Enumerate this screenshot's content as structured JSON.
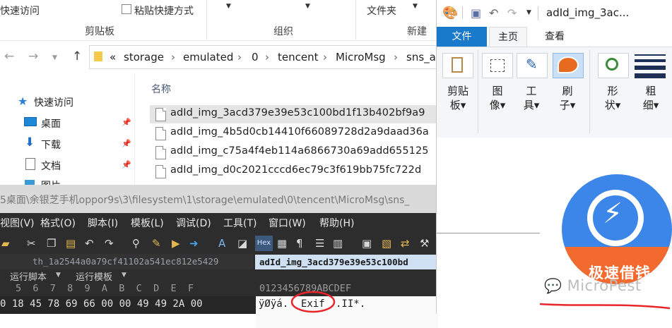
{
  "explorer": {
    "ribbon": {
      "quick_access": "快速访问",
      "paste_shortcut": "粘贴快捷方式",
      "new_folder": "文件夹",
      "groups": [
        "剪贴板",
        "组织",
        "新建"
      ]
    },
    "address": {
      "prefix": "«",
      "segments": [
        "storage",
        "emulated",
        "0",
        "tencent",
        "MicroMsg",
        "sns_ad"
      ],
      "sep": "›"
    },
    "nav": {
      "quick_access": "快速访问",
      "items": [
        "桌面",
        "下载",
        "文档",
        "图片"
      ]
    },
    "column_header": "名称",
    "files": [
      "adId_img_3acd379e39e53c100bd1f13b402bf9a9",
      "adId_img_4b5d0cb14410f66089728d2a9daad36a",
      "adId_img_c75a4f4eb114a6866730a69add655125",
      "adId_img_d0c2021cccd6ec79c3f619bb75fc722d"
    ]
  },
  "hexeditor": {
    "path": "5桌面\\余银芝手机oppor9s\\3\\filesystem\\1\\storage\\emulated\\0\\tencent\\MicroMsg\\sns_",
    "menu": [
      "视图(V)",
      "格式(O)",
      "脚本(I)",
      "模板(L)",
      "调试(D)",
      "工具(T)",
      "窗口(W)",
      "帮助(H)"
    ],
    "tabs": [
      "th_1a2544a0a79cf41102a541ec812e5429",
      "adId_img_3acd379e39e53c100bd"
    ],
    "sub": [
      "运行脚本",
      "运行模板"
    ],
    "col_header": "5  6  7  8  9  A  B  C  D  E  F",
    "ascii_header": "0123456789ABCDEF",
    "row_hex": "0 18 45 78 69 66 00 00 49 49 2A 00",
    "row_ascii_pre": "ÿØÿá.",
    "row_ascii_exif": "Exif",
    "row_ascii_post": ".II*.",
    "hex_badge": "Hex",
    "pilcrow": "¶"
  },
  "paint": {
    "title": "adId_img_3ac...",
    "tabs": {
      "file": "文件",
      "home": "主页",
      "view": "查看"
    },
    "tools": [
      {
        "label": "剪贴\n板▾"
      },
      {
        "label": "图\n像▾"
      },
      {
        "label": "工\n具▾"
      },
      {
        "label": "刷\n子▾"
      },
      {
        "label": "形\n状▾"
      },
      {
        "label": "粗\n细▾"
      }
    ],
    "logo_text": "极速借钱",
    "watermark": "MicroPest"
  },
  "colors": {
    "paint_tab_blue": "#1979ca",
    "logo_blue": "#3b86e8",
    "logo_orange": "#f26a2d",
    "annotation_red": "#e8262a"
  }
}
